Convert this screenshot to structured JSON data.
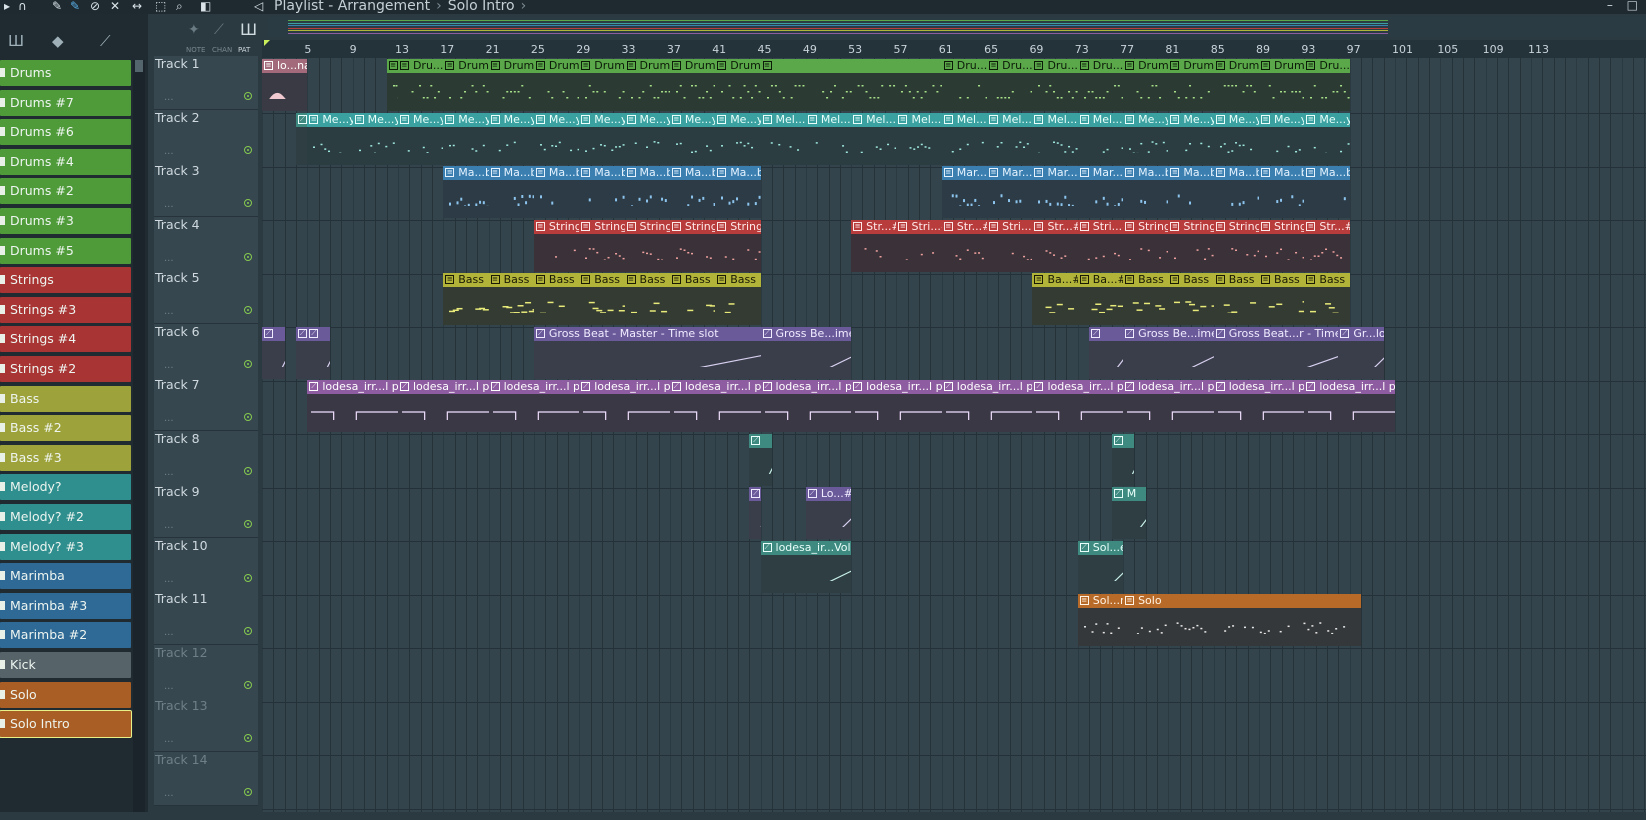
{
  "window": {
    "title": "Playlist - Arrangement",
    "subtitle": "Solo Intro",
    "controls": [
      "–",
      "□"
    ]
  },
  "toolbar": {
    "icons": [
      "menu-arrow-icon",
      "magnet-icon",
      "pencil-icon",
      "brush-icon",
      "delete-icon",
      "mute-icon",
      "slip-icon",
      "select-icon",
      "zoom-icon",
      "playback-icon"
    ]
  },
  "browser": {
    "mode_labels": [
      "NOTE",
      "CHAN",
      "PAT"
    ],
    "patterns": [
      {
        "label": "Drums",
        "color": "#4f9b3a"
      },
      {
        "label": "Drums #7",
        "color": "#4f9b3a"
      },
      {
        "label": "Drums #6",
        "color": "#4f9b3a"
      },
      {
        "label": "Drums #4",
        "color": "#4f9b3a"
      },
      {
        "label": "Drums #2",
        "color": "#4f9b3a"
      },
      {
        "label": "Drums #3",
        "color": "#4f9b3a"
      },
      {
        "label": "Drums #5",
        "color": "#4f9b3a"
      },
      {
        "label": "Strings",
        "color": "#a83434"
      },
      {
        "label": "Strings #3",
        "color": "#a83434"
      },
      {
        "label": "Strings #4",
        "color": "#a83434"
      },
      {
        "label": "Strings #2",
        "color": "#a83434"
      },
      {
        "label": "Bass",
        "color": "#9ea23a"
      },
      {
        "label": "Bass #2",
        "color": "#9ea23a"
      },
      {
        "label": "Bass #3",
        "color": "#9ea23a"
      },
      {
        "label": "Melody?",
        "color": "#2f8e8e"
      },
      {
        "label": "Melody? #2",
        "color": "#2f8e8e"
      },
      {
        "label": "Melody? #3",
        "color": "#2f8e8e"
      },
      {
        "label": "Marimba",
        "color": "#2f6a96"
      },
      {
        "label": "Marimba #3",
        "color": "#2f6a96"
      },
      {
        "label": "Marimba #2",
        "color": "#2f6a96"
      },
      {
        "label": "Kick",
        "color": "#56646a"
      },
      {
        "label": "Solo",
        "color": "#a85e24"
      },
      {
        "label": "Solo Intro",
        "color": "#a85e24"
      }
    ]
  },
  "tracks": [
    "Track 1",
    "Track 2",
    "Track 3",
    "Track 4",
    "Track 5",
    "Track 6",
    "Track 7",
    "Track 8",
    "Track 9",
    "Track 10",
    "Track 11",
    "Track 12",
    "Track 13",
    "Track 14"
  ],
  "ruler": {
    "ticks": [
      "5",
      "9",
      "13",
      "17",
      "21",
      "25",
      "29",
      "33",
      "37",
      "41",
      "45",
      "49",
      "53",
      "57",
      "61",
      "65",
      "69",
      "73",
      "77",
      "81",
      "85",
      "89",
      "93",
      "97",
      "101",
      "105",
      "109",
      "113"
    ]
  },
  "clips": [
    {
      "track": 0,
      "bar": 1,
      "len": 4,
      "label": "lo...nal",
      "kind": "audio"
    },
    {
      "track": 0,
      "bar": 12,
      "len": 1,
      "label": "",
      "kind": "drums"
    },
    {
      "track": 0,
      "bar": 13,
      "len": 4,
      "label": "Dru...6",
      "kind": "drums"
    },
    {
      "track": 0,
      "bar": 17,
      "len": 4,
      "label": "Drums",
      "kind": "drums"
    },
    {
      "track": 0,
      "bar": 21,
      "len": 4,
      "label": "Drums",
      "kind": "drums"
    },
    {
      "track": 0,
      "bar": 25,
      "len": 4,
      "label": "Drums",
      "kind": "drums"
    },
    {
      "track": 0,
      "bar": 29,
      "len": 4,
      "label": "Drums",
      "kind": "drums"
    },
    {
      "track": 0,
      "bar": 33,
      "len": 4,
      "label": "Drums",
      "kind": "drums"
    },
    {
      "track": 0,
      "bar": 37,
      "len": 4,
      "label": "Drums",
      "kind": "drums"
    },
    {
      "track": 0,
      "bar": 41,
      "len": 4,
      "label": "Drums",
      "kind": "drums"
    },
    {
      "track": 0,
      "bar": 45,
      "len": 16,
      "label": "",
      "kind": "drums"
    },
    {
      "track": 0,
      "bar": 61,
      "len": 4,
      "label": "Dru...3",
      "kind": "drums"
    },
    {
      "track": 0,
      "bar": 65,
      "len": 4,
      "label": "Dru...3",
      "kind": "drums"
    },
    {
      "track": 0,
      "bar": 69,
      "len": 4,
      "label": "Dru...5",
      "kind": "drums"
    },
    {
      "track": 0,
      "bar": 73,
      "len": 4,
      "label": "Dru...5",
      "kind": "drums"
    },
    {
      "track": 0,
      "bar": 77,
      "len": 4,
      "label": "Drums",
      "kind": "drums"
    },
    {
      "track": 0,
      "bar": 81,
      "len": 4,
      "label": "Drums",
      "kind": "drums"
    },
    {
      "track": 0,
      "bar": 85,
      "len": 4,
      "label": "Drums",
      "kind": "drums"
    },
    {
      "track": 0,
      "bar": 89,
      "len": 4,
      "label": "Drums",
      "kind": "drums"
    },
    {
      "track": 0,
      "bar": 93,
      "len": 4,
      "label": "Dru...7",
      "kind": "drums"
    },
    {
      "track": 1,
      "bar": 4,
      "len": 1,
      "label": "",
      "kind": "autoT"
    },
    {
      "track": 1,
      "bar": 5,
      "len": 4,
      "label": "Me...y?",
      "kind": "melody"
    },
    {
      "track": 1,
      "bar": 9,
      "len": 4,
      "label": "Me...y?",
      "kind": "melody"
    },
    {
      "track": 1,
      "bar": 13,
      "len": 4,
      "label": "Me...y?",
      "kind": "melody"
    },
    {
      "track": 1,
      "bar": 17,
      "len": 4,
      "label": "Me...y?",
      "kind": "melody"
    },
    {
      "track": 1,
      "bar": 21,
      "len": 4,
      "label": "Me...y?",
      "kind": "melody"
    },
    {
      "track": 1,
      "bar": 25,
      "len": 4,
      "label": "Me...y?",
      "kind": "melody"
    },
    {
      "track": 1,
      "bar": 29,
      "len": 4,
      "label": "Me...y?",
      "kind": "melody"
    },
    {
      "track": 1,
      "bar": 33,
      "len": 4,
      "label": "Me...y?",
      "kind": "melody"
    },
    {
      "track": 1,
      "bar": 37,
      "len": 4,
      "label": "Me...y?",
      "kind": "melody"
    },
    {
      "track": 1,
      "bar": 41,
      "len": 4,
      "label": "Me...y?",
      "kind": "melody"
    },
    {
      "track": 1,
      "bar": 45,
      "len": 4,
      "label": "Mel...2",
      "kind": "melody"
    },
    {
      "track": 1,
      "bar": 49,
      "len": 4,
      "label": "Mel...2",
      "kind": "melody"
    },
    {
      "track": 1,
      "bar": 53,
      "len": 4,
      "label": "Mel...2",
      "kind": "melody"
    },
    {
      "track": 1,
      "bar": 57,
      "len": 4,
      "label": "Mel...2",
      "kind": "melody"
    },
    {
      "track": 1,
      "bar": 61,
      "len": 4,
      "label": "Mel...2",
      "kind": "melody"
    },
    {
      "track": 1,
      "bar": 65,
      "len": 4,
      "label": "Mel...2",
      "kind": "melody"
    },
    {
      "track": 1,
      "bar": 69,
      "len": 4,
      "label": "Mel...2",
      "kind": "melody"
    },
    {
      "track": 1,
      "bar": 73,
      "len": 4,
      "label": "Mel...2",
      "kind": "melody"
    },
    {
      "track": 1,
      "bar": 77,
      "len": 4,
      "label": "Me...y?",
      "kind": "melody"
    },
    {
      "track": 1,
      "bar": 81,
      "len": 4,
      "label": "Me...y?",
      "kind": "melody"
    },
    {
      "track": 1,
      "bar": 85,
      "len": 4,
      "label": "Me...y?",
      "kind": "melody"
    },
    {
      "track": 1,
      "bar": 89,
      "len": 4,
      "label": "Me...y?",
      "kind": "melody"
    },
    {
      "track": 1,
      "bar": 93,
      "len": 4,
      "label": "Me...y?",
      "kind": "melody"
    },
    {
      "track": 2,
      "bar": 17,
      "len": 4,
      "label": "Ma...ba",
      "kind": "marimba"
    },
    {
      "track": 2,
      "bar": 21,
      "len": 4,
      "label": "Ma...ba",
      "kind": "marimba"
    },
    {
      "track": 2,
      "bar": 25,
      "len": 4,
      "label": "Ma...ba",
      "kind": "marimba"
    },
    {
      "track": 2,
      "bar": 29,
      "len": 4,
      "label": "Ma...ba",
      "kind": "marimba"
    },
    {
      "track": 2,
      "bar": 33,
      "len": 4,
      "label": "Ma...ba",
      "kind": "marimba"
    },
    {
      "track": 2,
      "bar": 37,
      "len": 4,
      "label": "Ma...ba",
      "kind": "marimba"
    },
    {
      "track": 2,
      "bar": 41,
      "len": 4,
      "label": "Ma...ba",
      "kind": "marimba"
    },
    {
      "track": 2,
      "bar": 61,
      "len": 4,
      "label": "Mar...3",
      "kind": "marimba"
    },
    {
      "track": 2,
      "bar": 65,
      "len": 4,
      "label": "Mar...3",
      "kind": "marimba"
    },
    {
      "track": 2,
      "bar": 69,
      "len": 4,
      "label": "Mar...3",
      "kind": "marimba"
    },
    {
      "track": 2,
      "bar": 73,
      "len": 4,
      "label": "Mar...3",
      "kind": "marimba"
    },
    {
      "track": 2,
      "bar": 77,
      "len": 4,
      "label": "Ma...ba",
      "kind": "marimba"
    },
    {
      "track": 2,
      "bar": 81,
      "len": 4,
      "label": "Ma...ba",
      "kind": "marimba"
    },
    {
      "track": 2,
      "bar": 85,
      "len": 4,
      "label": "Ma...ba",
      "kind": "marimba"
    },
    {
      "track": 2,
      "bar": 89,
      "len": 4,
      "label": "Ma...ba",
      "kind": "marimba"
    },
    {
      "track": 2,
      "bar": 93,
      "len": 4,
      "label": "Ma...ba",
      "kind": "marimba"
    },
    {
      "track": 3,
      "bar": 25,
      "len": 4,
      "label": "Strings",
      "kind": "strings"
    },
    {
      "track": 3,
      "bar": 29,
      "len": 4,
      "label": "Strings",
      "kind": "strings"
    },
    {
      "track": 3,
      "bar": 33,
      "len": 4,
      "label": "Strings",
      "kind": "strings"
    },
    {
      "track": 3,
      "bar": 37,
      "len": 4,
      "label": "Strings",
      "kind": "strings"
    },
    {
      "track": 3,
      "bar": 41,
      "len": 4,
      "label": "Strings",
      "kind": "strings"
    },
    {
      "track": 3,
      "bar": 53,
      "len": 4,
      "label": "Str...#2",
      "kind": "strings"
    },
    {
      "track": 3,
      "bar": 57,
      "len": 4,
      "label": "Stri...#2",
      "kind": "strings"
    },
    {
      "track": 3,
      "bar": 61,
      "len": 4,
      "label": "Str...#2",
      "kind": "strings"
    },
    {
      "track": 3,
      "bar": 65,
      "len": 4,
      "label": "Stri...#2",
      "kind": "strings"
    },
    {
      "track": 3,
      "bar": 69,
      "len": 4,
      "label": "Str...#2",
      "kind": "strings"
    },
    {
      "track": 3,
      "bar": 73,
      "len": 4,
      "label": "Stri...#2",
      "kind": "strings"
    },
    {
      "track": 3,
      "bar": 77,
      "len": 4,
      "label": "Strings",
      "kind": "strings"
    },
    {
      "track": 3,
      "bar": 81,
      "len": 4,
      "label": "Strings",
      "kind": "strings"
    },
    {
      "track": 3,
      "bar": 85,
      "len": 4,
      "label": "Strings",
      "kind": "strings"
    },
    {
      "track": 3,
      "bar": 89,
      "len": 4,
      "label": "Strings",
      "kind": "strings"
    },
    {
      "track": 3,
      "bar": 93,
      "len": 4,
      "label": "Str...#3",
      "kind": "strings"
    },
    {
      "track": 4,
      "bar": 17,
      "len": 4,
      "label": "Bass",
      "kind": "bass"
    },
    {
      "track": 4,
      "bar": 21,
      "len": 4,
      "label": "Bass",
      "kind": "bass"
    },
    {
      "track": 4,
      "bar": 25,
      "len": 4,
      "label": "Bass",
      "kind": "bass"
    },
    {
      "track": 4,
      "bar": 29,
      "len": 4,
      "label": "Bass",
      "kind": "bass"
    },
    {
      "track": 4,
      "bar": 33,
      "len": 4,
      "label": "Bass",
      "kind": "bass"
    },
    {
      "track": 4,
      "bar": 37,
      "len": 4,
      "label": "Bass",
      "kind": "bass"
    },
    {
      "track": 4,
      "bar": 41,
      "len": 4,
      "label": "Bass",
      "kind": "bass"
    },
    {
      "track": 4,
      "bar": 69,
      "len": 4,
      "label": "Ba...#3",
      "kind": "bass"
    },
    {
      "track": 4,
      "bar": 73,
      "len": 4,
      "label": "Ba...#3",
      "kind": "bass"
    },
    {
      "track": 4,
      "bar": 77,
      "len": 4,
      "label": "Bass",
      "kind": "bass"
    },
    {
      "track": 4,
      "bar": 81,
      "len": 4,
      "label": "Bass",
      "kind": "bass"
    },
    {
      "track": 4,
      "bar": 85,
      "len": 4,
      "label": "Bass",
      "kind": "bass"
    },
    {
      "track": 4,
      "bar": 89,
      "len": 4,
      "label": "Bass",
      "kind": "bass"
    },
    {
      "track": 4,
      "bar": 93,
      "len": 4,
      "label": "Bass",
      "kind": "bass"
    },
    {
      "track": 5,
      "bar": 1,
      "len": 2,
      "label": "",
      "kind": "auto"
    },
    {
      "track": 5,
      "bar": 4,
      "len": 1,
      "label": "",
      "kind": "auto"
    },
    {
      "track": 5,
      "bar": 5,
      "len": 2,
      "label": "",
      "kind": "auto"
    },
    {
      "track": 5,
      "bar": 25,
      "len": 20,
      "label": "Gross Beat - Master - Time slot",
      "kind": "auto"
    },
    {
      "track": 5,
      "bar": 45,
      "len": 8,
      "label": "Gross Be...ime slot",
      "kind": "auto"
    },
    {
      "track": 5,
      "bar": 74,
      "len": 3,
      "label": "",
      "kind": "auto"
    },
    {
      "track": 5,
      "bar": 77,
      "len": 8,
      "label": "Gross Be...ime slot",
      "kind": "auto"
    },
    {
      "track": 5,
      "bar": 85,
      "len": 11,
      "label": "Gross Beat...r - Time slot",
      "kind": "auto"
    },
    {
      "track": 5,
      "bar": 96,
      "len": 4,
      "label": "Gr...lot",
      "kind": "auto"
    },
    {
      "track": 6,
      "bar": 5,
      "len": 8,
      "label": "lodesa_irr...l pitch",
      "kind": "autop"
    },
    {
      "track": 6,
      "bar": 13,
      "len": 8,
      "label": "lodesa_irr...l pitch",
      "kind": "autop"
    },
    {
      "track": 6,
      "bar": 21,
      "len": 8,
      "label": "lodesa_irr...l pitch",
      "kind": "autop"
    },
    {
      "track": 6,
      "bar": 29,
      "len": 8,
      "label": "lodesa_irr...l pitch",
      "kind": "autop"
    },
    {
      "track": 6,
      "bar": 37,
      "len": 8,
      "label": "lodesa_irr...l pitch",
      "kind": "autop"
    },
    {
      "track": 6,
      "bar": 45,
      "len": 8,
      "label": "lodesa_irr...l pitch",
      "kind": "autop"
    },
    {
      "track": 6,
      "bar": 53,
      "len": 8,
      "label": "lodesa_irr...l pitch",
      "kind": "autop"
    },
    {
      "track": 6,
      "bar": 61,
      "len": 8,
      "label": "lodesa_irr...l pitch",
      "kind": "autop"
    },
    {
      "track": 6,
      "bar": 69,
      "len": 8,
      "label": "lodesa_irr...l pitch",
      "kind": "autop"
    },
    {
      "track": 6,
      "bar": 77,
      "len": 8,
      "label": "lodesa_irr...l pitch",
      "kind": "autop"
    },
    {
      "track": 6,
      "bar": 85,
      "len": 8,
      "label": "lodesa_irr...l pitch",
      "kind": "autop"
    },
    {
      "track": 6,
      "bar": 93,
      "len": 8,
      "label": "lodesa_irr...l pitch",
      "kind": "autop"
    },
    {
      "track": 7,
      "bar": 44,
      "len": 2,
      "label": "",
      "kind": "autoT"
    },
    {
      "track": 7,
      "bar": 76,
      "len": 2,
      "label": "",
      "kind": "autoT"
    },
    {
      "track": 8,
      "bar": 44,
      "len": 1,
      "label": "",
      "kind": "auto"
    },
    {
      "track": 8,
      "bar": 49,
      "len": 4,
      "label": "Lo...#3",
      "kind": "auto"
    },
    {
      "track": 8,
      "bar": 76,
      "len": 3,
      "label": "M",
      "kind": "autoT"
    },
    {
      "track": 9,
      "bar": 45,
      "len": 8,
      "label": "lodesa_ir...Volume",
      "kind": "autoT"
    },
    {
      "track": 9,
      "bar": 73,
      "len": 4,
      "label": "Sol...e",
      "kind": "autoT"
    },
    {
      "track": 10,
      "bar": 73,
      "len": 4,
      "label": "Sol...ro",
      "kind": "solo"
    },
    {
      "track": 10,
      "bar": 77,
      "len": 21,
      "label": "Solo",
      "kind": "solo"
    }
  ]
}
